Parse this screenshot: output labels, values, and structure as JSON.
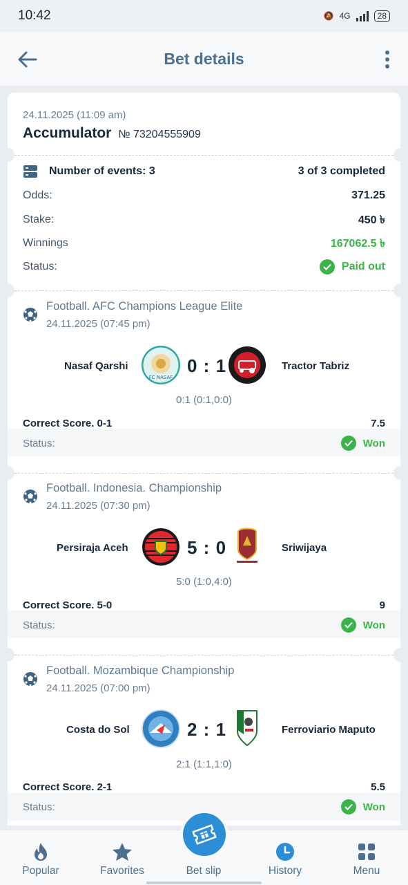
{
  "status_bar": {
    "time": "10:42",
    "battery": "28",
    "network": "4G"
  },
  "header": {
    "title": "Bet details"
  },
  "bet": {
    "date": "24.11.2025 (11:09 am)",
    "type": "Accumulator",
    "number": "№ 73204555909",
    "events_label": "Number of events: 3",
    "completed": "3 of 3 completed",
    "odds_label": "Odds:",
    "odds_value": "371.25",
    "stake_label": "Stake:",
    "stake_value": "450 ৳",
    "winnings_label": "Winnings",
    "winnings_value": "167062.5 ৳",
    "status_label": "Status:",
    "status_value": "Paid out"
  },
  "events": [
    {
      "league": "Football. AFC Champions League Elite",
      "date": "24.11.2025 (07:45 pm)",
      "home": "Nasaf Qarshi",
      "away": "Tractor Tabriz",
      "score": "0 : 1",
      "detail": "0:1 (0:1,0:0)",
      "market": "Correct Score. 0-1",
      "odds": "7.5",
      "status_label": "Status:",
      "status": "Won"
    },
    {
      "league": "Football. Indonesia. Championship",
      "date": "24.11.2025 (07:30 pm)",
      "home": "Persiraja Aceh",
      "away": "Sriwijaya",
      "score": "5 : 0",
      "detail": "5:0 (1:0,4:0)",
      "market": "Correct Score. 5-0",
      "odds": "9",
      "status_label": "Status:",
      "status": "Won"
    },
    {
      "league": "Football. Mozambique Championship",
      "date": "24.11.2025 (07:00 pm)",
      "home": "Costa do Sol",
      "away": "Ferroviario Maputo",
      "score": "2 : 1",
      "detail": "2:1 (1:1,1:0)",
      "market": "Correct Score. 2-1",
      "odds": "5.5",
      "status_label": "Status:",
      "status": "Won"
    }
  ],
  "nav": {
    "popular": "Popular",
    "favorites": "Favorites",
    "betslip": "Bet slip",
    "history": "History",
    "menu": "Menu"
  },
  "colors": {
    "accent": "#2b8ed6",
    "won": "#3bb54a",
    "header_text": "#4d6f8e"
  },
  "icons": [
    "back-arrow-icon",
    "more-vert-icon",
    "events-list-icon",
    "check-icon",
    "football-icon",
    "flame-icon",
    "star-icon",
    "ticket-icon",
    "clock-icon",
    "grid-icon"
  ]
}
